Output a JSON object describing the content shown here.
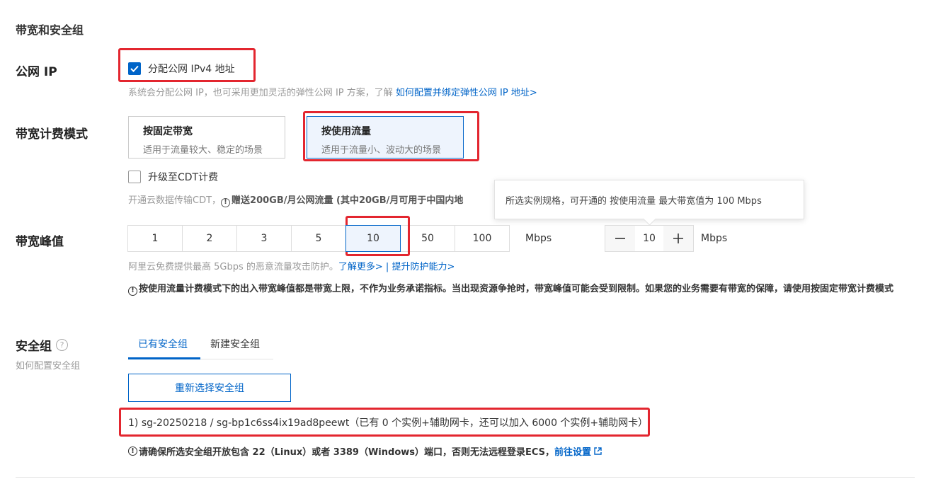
{
  "section_title": "带宽和安全组",
  "public_ip": {
    "label": "公网 IP",
    "checkbox_label": "分配公网 IPv4 地址",
    "checked": true,
    "hint": "系统会分配公网 IP，也可采用更加灵活的弹性公网 IP 方案，了解",
    "hint_link": "如何配置并绑定弹性公网 IP 地址>"
  },
  "billing": {
    "label": "带宽计费模式",
    "options": [
      {
        "title": "按固定带宽",
        "desc": "适用于流量较大、稳定的场景"
      },
      {
        "title": "按使用流量",
        "desc": "适用于流量小、波动大的场景"
      }
    ],
    "selected": "按使用流量",
    "cdt_label": "升级至CDT计费",
    "cdt_hint_a": "开通云数据传输CDT，",
    "cdt_hint_b": "赠送200GB/月公网流量 (其中20GB/月可用于中国内地"
  },
  "tooltip": {
    "text": "所选实例规格，可开通的 按使用流量 最大带宽值为 100 Mbps"
  },
  "bandwidth": {
    "label": "带宽峰值",
    "options": [
      "1",
      "2",
      "3",
      "5",
      "10",
      "50",
      "100"
    ],
    "selected": "10",
    "unit": "Mbps",
    "stepper_value": "10",
    "stepper_unit": "Mbps",
    "ddos_hint": "阿里云免费提供最高 5Gbps 的恶意流量攻击防护。",
    "ddos_link1": "了解更多>",
    "ddos_sep": " | ",
    "ddos_link2": "提升防护能力>",
    "warning": "按使用流量计费模式下的出入带宽峰值都是带宽上限，不作为业务承诺指标。当出现资源争抢时，带宽峰值可能会受到限制。如果您的业务需要有带宽的保障，请使用按固定带宽计费模式"
  },
  "security_group": {
    "label": "安全组",
    "sub_label": "如何配置安全组",
    "help_icon": "question-circle-icon",
    "tabs": [
      "已有安全组",
      "新建安全组"
    ],
    "active_tab": "已有安全组",
    "reselect_label": "重新选择安全组",
    "selected_text": "1) sg-20250218 / sg-bp1c6ss4ix19ad8peewt（已有 0 个实例+辅助网卡，还可以加入 6000 个实例+辅助网卡）",
    "warning": "请确保所选安全组开放包含 22（Linux）或者 3389（Windows）端口，否则无法远程登录ECS，",
    "warning_link": "前往设置"
  },
  "colors": {
    "primary": "#0064c8",
    "highlight": "#e3262f",
    "selected_bg": "#eef4fd"
  }
}
